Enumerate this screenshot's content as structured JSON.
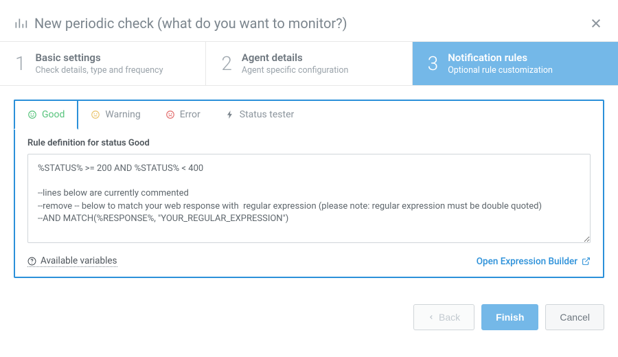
{
  "header": {
    "title": "New periodic check (what do you want to monitor?)"
  },
  "steps": [
    {
      "num": "1",
      "title": "Basic settings",
      "sub": "Check details, type and frequency"
    },
    {
      "num": "2",
      "title": "Agent details",
      "sub": "Agent specific configuration"
    },
    {
      "num": "3",
      "title": "Notification rules",
      "sub": "Optional rule customization"
    }
  ],
  "tabs": {
    "good": "Good",
    "warning": "Warning",
    "error": "Error",
    "tester": "Status tester"
  },
  "rule": {
    "label": "Rule definition for status Good",
    "value": "%STATUS% >= 200 AND %STATUS% < 400\n\n--lines below are currently commented\n--remove -- below to match your web response with  regular expression (please note: regular expression must be double quoted)\n--AND MATCH(%RESPONSE%, \"YOUR_REGULAR_EXPRESSION\")"
  },
  "links": {
    "available_vars": "Available variables",
    "builder": "Open Expression Builder"
  },
  "footer": {
    "back": "Back",
    "finish": "Finish",
    "cancel": "Cancel"
  }
}
